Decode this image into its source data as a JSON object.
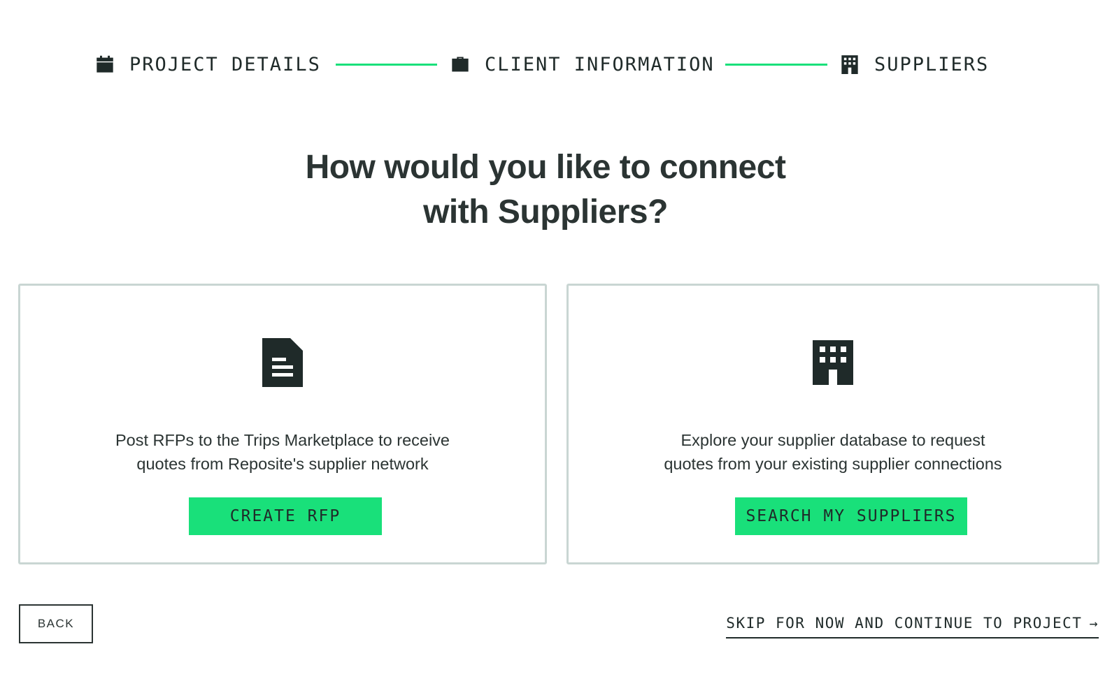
{
  "stepper": {
    "steps": [
      {
        "label": "PROJECT DETAILS",
        "icon": "calendar-icon"
      },
      {
        "label": "CLIENT INFORMATION",
        "icon": "briefcase-icon"
      },
      {
        "label": "SUPPLIERS",
        "icon": "building-icon"
      }
    ],
    "connector_color": "#19e07a"
  },
  "headline": {
    "line1": "How would you like to connect",
    "line2": "with Suppliers?"
  },
  "cards": [
    {
      "icon": "document-icon",
      "description_line1": "Post RFPs to the Trips Marketplace to receive",
      "description_line2": "quotes from Reposite's supplier network",
      "button_label": "CREATE RFP"
    },
    {
      "icon": "building-icon",
      "description_line1": "Explore your supplier database to request",
      "description_line2": "quotes from your existing supplier connections",
      "button_label": "SEARCH MY SUPPLIERS"
    }
  ],
  "footer": {
    "back_label": "BACK",
    "skip_label": "SKIP FOR NOW AND CONTINUE TO PROJECT",
    "skip_arrow": "→"
  },
  "colors": {
    "accent": "#19e07a",
    "text": "#2b3433",
    "card_border": "#c9d6d3"
  }
}
